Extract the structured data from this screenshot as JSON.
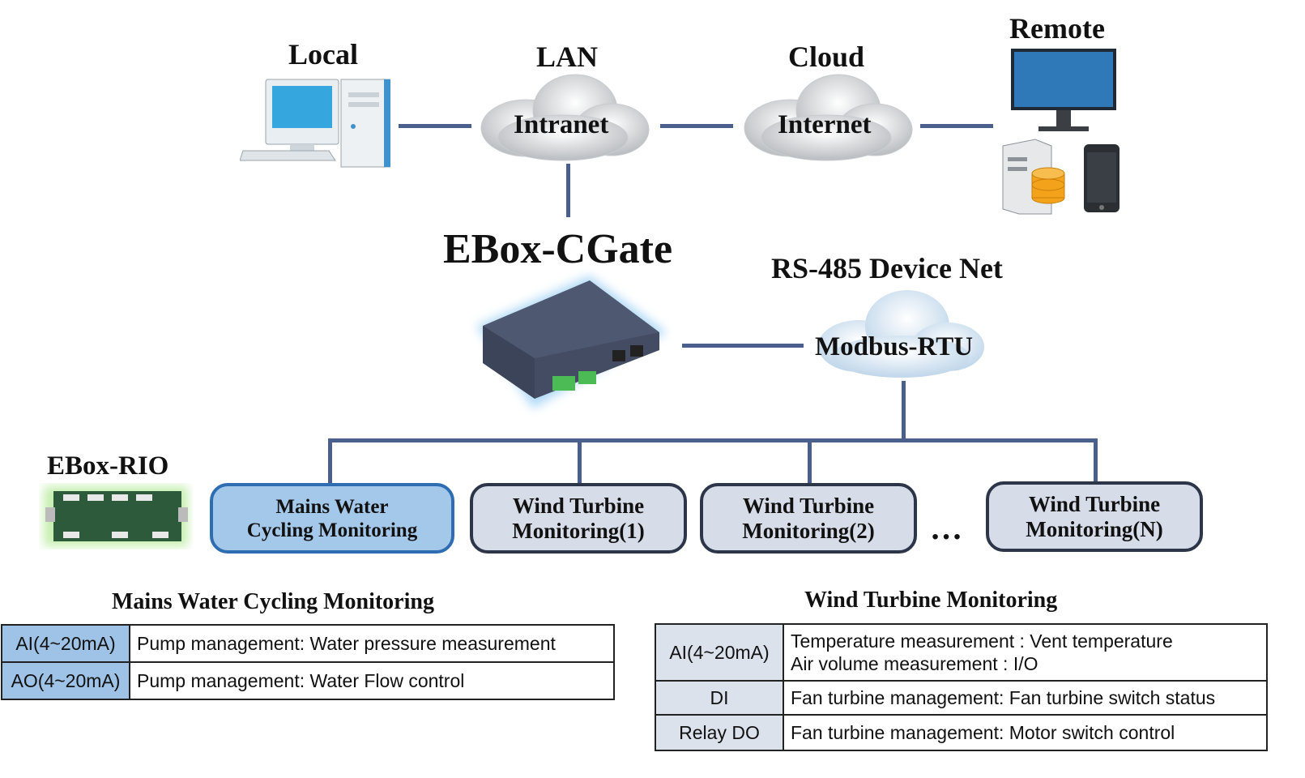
{
  "top": {
    "local": "Local",
    "lan": "LAN",
    "intranet": "Intranet",
    "cloud": "Cloud",
    "internet": "Internet",
    "remote": "Remote"
  },
  "gateway": {
    "title": "EBox-CGate"
  },
  "rs485": {
    "title": "RS-485 Device Net",
    "cloud_label": "Modbus-RTU"
  },
  "rio": {
    "title": "EBox-RIO"
  },
  "nodes": [
    {
      "label1": "Mains Water",
      "label2": "Cycling  Monitoring"
    },
    {
      "label1": "Wind Turbine",
      "label2": "Monitoring(1)"
    },
    {
      "label1": "Wind Turbine",
      "label2": "Monitoring(2)"
    },
    {
      "label1": "Wind Turbine",
      "label2": "Monitoring(N)"
    }
  ],
  "ellipsis": "…",
  "mains_table": {
    "title": "Mains Water Cycling  Monitoring",
    "rows": [
      {
        "key": "AI(4~20mA)",
        "value": "Pump management: Water pressure measurement"
      },
      {
        "key": "AO(4~20mA)",
        "value": "Pump management: Water Flow control"
      }
    ]
  },
  "wind_table": {
    "title": "Wind Turbine Monitoring",
    "rows": [
      {
        "key": "AI(4~20mA)",
        "value": "Temperature measurement : Vent temperature",
        "value2": "Air volume measurement : I/O"
      },
      {
        "key": "DI",
        "value": "Fan turbine management: Fan turbine switch status"
      },
      {
        "key": "Relay DO",
        "value": "Fan turbine management: Motor switch control"
      }
    ]
  },
  "colors": {
    "line": "#4a5f8c",
    "mains_node": "#a4c8ea",
    "wind_node": "#d6dde8",
    "mains_key": "#9ec3e6",
    "wind_key": "#dbe2ec"
  }
}
